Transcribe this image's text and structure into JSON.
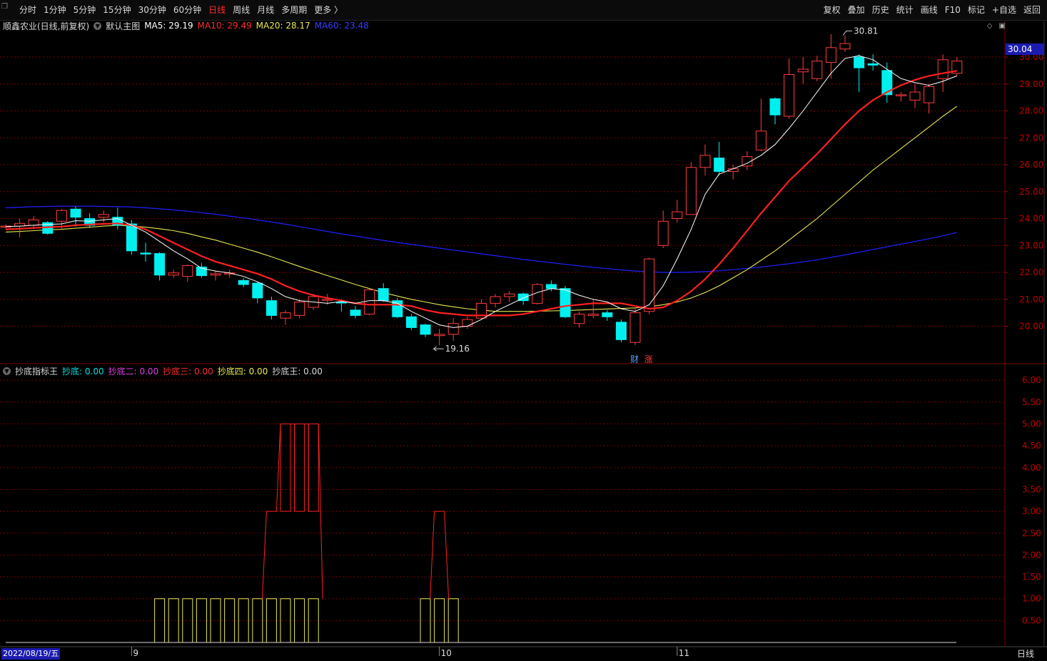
{
  "toolbar": {
    "periods": [
      "分时",
      "1分钟",
      "5分钟",
      "15分钟",
      "30分钟",
      "60分钟",
      "日线",
      "周线",
      "月线",
      "多周期",
      "更多 〉"
    ],
    "active_period": "日线",
    "tools": [
      "复权",
      "叠加",
      "历史",
      "统计",
      "画线",
      "F10",
      "标记",
      "+自选",
      "返回"
    ]
  },
  "main_info": {
    "stock": "顺鑫农业(日线,前复权)",
    "template": "默认主图",
    "ma5": "MA5: 29.19",
    "ma10": "MA10: 29.49",
    "ma20": "MA20: 28.17",
    "ma60": "MA60: 23.48"
  },
  "sub_info": {
    "name": "抄底指标王",
    "s1": "抄底: 0.00",
    "s2": "抄底二: 0.00",
    "s3": "抄底三: 0.00",
    "s4": "抄底四: 0.00",
    "s5": "抄底王: 0.00"
  },
  "last_price": "30.04",
  "date_label": "2022/08/19/五",
  "period_label": "日线",
  "markers": {
    "fin": "财",
    "rise": "涨",
    "high_label": "30.81",
    "low_label": "19.16"
  },
  "colors": {
    "up": "#ff3c3c",
    "down": "#00f0f0",
    "ma5": "#ffffff",
    "ma10": "#ff2020",
    "ma20": "#e8e850",
    "ma60": "#2020ff",
    "grid": "#7a0000"
  },
  "chart_data": [
    {
      "type": "candlestick",
      "title": "顺鑫农业(日线,前复权)",
      "ylim": [
        19.2,
        31.0
      ],
      "yticks": [
        20,
        21,
        22,
        23,
        24,
        25,
        26,
        27,
        28,
        29,
        30
      ],
      "xticks": [
        {
          "index": 9,
          "label": "9"
        },
        {
          "index": 31,
          "label": "10"
        },
        {
          "index": 48,
          "label": "11"
        }
      ],
      "ohlc": [
        [
          23.72,
          23.72,
          23.78,
          23.62
        ],
        [
          23.72,
          23.82,
          24.0,
          23.3
        ],
        [
          23.75,
          23.95,
          24.1,
          23.6
        ],
        [
          23.85,
          23.45,
          23.9,
          23.4
        ],
        [
          23.9,
          24.3,
          24.35,
          23.6
        ],
        [
          24.35,
          24.05,
          24.45,
          23.7
        ],
        [
          24.0,
          23.75,
          24.2,
          23.65
        ],
        [
          24.05,
          24.15,
          24.3,
          23.85
        ],
        [
          24.05,
          23.75,
          24.4,
          23.6
        ],
        [
          23.8,
          22.8,
          23.95,
          22.65
        ],
        [
          22.72,
          22.7,
          23.1,
          22.4
        ],
        [
          22.7,
          21.9,
          22.75,
          21.7
        ],
        [
          21.9,
          21.98,
          22.1,
          21.8
        ],
        [
          21.85,
          22.25,
          22.3,
          21.65
        ],
        [
          22.2,
          21.88,
          22.35,
          21.8
        ],
        [
          21.9,
          21.95,
          22.05,
          21.7
        ],
        [
          21.95,
          21.98,
          22.1,
          21.8
        ],
        [
          21.7,
          21.55,
          21.78,
          21.45
        ],
        [
          21.6,
          21.05,
          21.65,
          20.85
        ],
        [
          20.95,
          20.4,
          21.1,
          20.25
        ],
        [
          20.3,
          20.5,
          20.6,
          20.05
        ],
        [
          20.4,
          20.9,
          21.0,
          20.3
        ],
        [
          20.7,
          21.1,
          21.2,
          20.6
        ],
        [
          21.0,
          21.0,
          21.2,
          20.8
        ],
        [
          20.9,
          20.88,
          21.0,
          20.55
        ],
        [
          20.6,
          20.4,
          20.75,
          20.3
        ],
        [
          20.45,
          21.35,
          21.4,
          20.4
        ],
        [
          21.4,
          20.95,
          21.6,
          20.9
        ],
        [
          20.95,
          20.35,
          21.05,
          20.3
        ],
        [
          20.35,
          19.95,
          20.45,
          19.85
        ],
        [
          20.05,
          19.7,
          20.1,
          19.6
        ],
        [
          19.65,
          19.7,
          19.9,
          19.3
        ],
        [
          19.7,
          20.1,
          20.3,
          19.45
        ],
        [
          20.0,
          20.25,
          20.35,
          19.9
        ],
        [
          20.3,
          20.85,
          21.0,
          20.25
        ],
        [
          20.85,
          21.1,
          21.2,
          20.7
        ],
        [
          21.1,
          21.2,
          21.3,
          20.9
        ],
        [
          21.2,
          20.95,
          21.25,
          20.8
        ],
        [
          20.85,
          21.55,
          21.6,
          20.8
        ],
        [
          21.55,
          21.4,
          21.7,
          21.3
        ],
        [
          21.4,
          20.35,
          21.5,
          20.3
        ],
        [
          20.1,
          20.45,
          20.55,
          19.95
        ],
        [
          20.4,
          20.45,
          21.0,
          20.3
        ],
        [
          20.5,
          20.35,
          20.6,
          20.2
        ],
        [
          20.15,
          19.5,
          20.25,
          19.4
        ],
        [
          19.4,
          20.5,
          20.7,
          19.3
        ],
        [
          20.55,
          22.5,
          22.55,
          20.45
        ],
        [
          23.0,
          23.9,
          24.3,
          22.9
        ],
        [
          24.0,
          24.25,
          24.7,
          23.85
        ],
        [
          24.15,
          25.9,
          26.1,
          24.15
        ],
        [
          25.9,
          26.35,
          26.75,
          25.6
        ],
        [
          26.25,
          25.75,
          26.85,
          25.6
        ],
        [
          25.75,
          25.85,
          26.0,
          25.45
        ],
        [
          25.95,
          26.3,
          26.5,
          25.8
        ],
        [
          26.55,
          27.25,
          28.45,
          26.5
        ],
        [
          28.45,
          27.85,
          28.5,
          27.5
        ],
        [
          27.8,
          29.35,
          29.95,
          27.7
        ],
        [
          29.45,
          29.55,
          30.0,
          29.0
        ],
        [
          29.2,
          29.85,
          30.05,
          29.1
        ],
        [
          29.8,
          30.35,
          30.85,
          29.2
        ],
        [
          30.3,
          30.5,
          30.81,
          30.2
        ],
        [
          30.0,
          29.6,
          30.1,
          28.7
        ],
        [
          29.75,
          29.7,
          30.1,
          29.5
        ],
        [
          29.5,
          28.6,
          29.8,
          28.3
        ],
        [
          28.6,
          28.6,
          28.7,
          28.35
        ],
        [
          28.4,
          28.7,
          29.0,
          28.1
        ],
        [
          28.3,
          28.9,
          29.0,
          27.9
        ],
        [
          29.2,
          29.9,
          30.1,
          28.7
        ],
        [
          29.4,
          29.85,
          30.0,
          29.3
        ]
      ],
      "ma5": [
        23.7,
        23.72,
        23.75,
        23.78,
        23.8,
        23.92,
        23.9,
        23.95,
        24.0,
        23.75,
        23.5,
        23.15,
        22.8,
        22.5,
        22.15,
        22.05,
        21.98,
        21.85,
        21.65,
        21.4,
        21.1,
        20.95,
        20.9,
        20.85,
        20.92,
        20.85,
        20.95,
        20.95,
        20.85,
        20.55,
        20.3,
        20.05,
        19.95,
        20.0,
        20.25,
        20.55,
        20.8,
        21.05,
        21.25,
        21.4,
        21.35,
        21.15,
        21.0,
        20.9,
        20.65,
        20.55,
        20.8,
        21.5,
        22.5,
        23.6,
        24.9,
        25.65,
        25.85,
        26.05,
        26.35,
        26.75,
        27.35,
        28.0,
        28.7,
        29.4,
        29.95,
        30.05,
        29.9,
        29.55,
        29.2,
        29.05,
        28.95,
        29.1,
        29.3
      ],
      "ma10": [
        23.6,
        23.62,
        23.65,
        23.68,
        23.7,
        23.75,
        23.78,
        23.8,
        23.82,
        23.75,
        23.6,
        23.35,
        23.1,
        22.85,
        22.6,
        22.4,
        22.25,
        22.1,
        21.95,
        21.75,
        21.5,
        21.3,
        21.15,
        21.05,
        20.95,
        20.85,
        20.8,
        20.8,
        20.8,
        20.75,
        20.6,
        20.5,
        20.45,
        20.4,
        20.4,
        20.4,
        20.4,
        20.45,
        20.55,
        20.65,
        20.75,
        20.8,
        20.85,
        20.85,
        20.85,
        20.75,
        20.65,
        20.7,
        20.95,
        21.3,
        21.75,
        22.3,
        22.9,
        23.55,
        24.2,
        24.8,
        25.4,
        25.9,
        26.4,
        26.95,
        27.5,
        28.0,
        28.4,
        28.7,
        28.95,
        29.15,
        29.3,
        29.4,
        29.49
      ],
      "ma20": [
        23.5,
        23.52,
        23.55,
        23.58,
        23.6,
        23.64,
        23.68,
        23.72,
        23.75,
        23.72,
        23.68,
        23.62,
        23.55,
        23.45,
        23.32,
        23.2,
        23.05,
        22.9,
        22.75,
        22.58,
        22.4,
        22.22,
        22.05,
        21.88,
        21.72,
        21.55,
        21.4,
        21.25,
        21.12,
        21.0,
        20.9,
        20.8,
        20.72,
        20.65,
        20.6,
        20.55,
        20.55,
        20.55,
        20.56,
        20.57,
        20.58,
        20.6,
        20.62,
        20.64,
        20.66,
        20.68,
        20.72,
        20.8,
        20.9,
        21.05,
        21.25,
        21.5,
        21.8,
        22.1,
        22.45,
        22.8,
        23.2,
        23.6,
        24.0,
        24.45,
        24.9,
        25.35,
        25.8,
        26.2,
        26.6,
        27.0,
        27.4,
        27.8,
        28.17
      ],
      "ma60": [
        24.4,
        24.42,
        24.44,
        24.45,
        24.46,
        24.46,
        24.46,
        24.45,
        24.44,
        24.43,
        24.4,
        24.36,
        24.32,
        24.27,
        24.22,
        24.16,
        24.09,
        24.02,
        23.95,
        23.87,
        23.79,
        23.7,
        23.61,
        23.52,
        23.43,
        23.35,
        23.27,
        23.19,
        23.11,
        23.04,
        22.97,
        22.9,
        22.83,
        22.76,
        22.69,
        22.62,
        22.55,
        22.48,
        22.42,
        22.36,
        22.3,
        22.24,
        22.19,
        22.14,
        22.09,
        22.05,
        22.02,
        22.0,
        22.0,
        22.01,
        22.03,
        22.06,
        22.1,
        22.15,
        22.2,
        22.26,
        22.32,
        22.39,
        22.47,
        22.56,
        22.65,
        22.75,
        22.85,
        22.95,
        23.05,
        23.15,
        23.25,
        23.36,
        23.48
      ],
      "high_marker": {
        "index": 60,
        "value": 30.81
      },
      "low_marker": {
        "index": 31,
        "value": 19.16
      }
    },
    {
      "type": "step-area",
      "title": "抄底指标王",
      "ylim": [
        0.0,
        6.0
      ],
      "yticks": [
        0.5,
        1.0,
        1.5,
        2.0,
        2.5,
        3.0,
        3.5,
        4.0,
        4.5,
        5.0,
        5.5,
        6.0
      ],
      "series": [
        {
          "name": "抄底四",
          "color": "#e8e850",
          "values": [
            0,
            0,
            0,
            0,
            0,
            0,
            0,
            0,
            0,
            0,
            0,
            1,
            1,
            1,
            1,
            1,
            1,
            1,
            1,
            1,
            1,
            1,
            1,
            0,
            0,
            0,
            0,
            0,
            0,
            0,
            1,
            1,
            1,
            0,
            0,
            0,
            0,
            0,
            0,
            0,
            0,
            0,
            0,
            0,
            0,
            0,
            0,
            0,
            0,
            0,
            0,
            0,
            0,
            0,
            0,
            0,
            0,
            0,
            0,
            0,
            0,
            0,
            0,
            0,
            0,
            0,
            0,
            0,
            0
          ]
        },
        {
          "name": "抄底三",
          "color": "#ff2020",
          "values": [
            0,
            0,
            0,
            0,
            0,
            0,
            0,
            0,
            0,
            0,
            0,
            0,
            0,
            0,
            0,
            0,
            0,
            0,
            0,
            3,
            5,
            5,
            5,
            0,
            0,
            0,
            0,
            0,
            0,
            0,
            0,
            3,
            0,
            0,
            0,
            0,
            0,
            0,
            0,
            0,
            0,
            0,
            0,
            0,
            0,
            0,
            0,
            0,
            0,
            0,
            0,
            0,
            0,
            0,
            0,
            0,
            0,
            0,
            0,
            0,
            0,
            0,
            0,
            0,
            0,
            0,
            0,
            0,
            0
          ]
        }
      ]
    }
  ]
}
